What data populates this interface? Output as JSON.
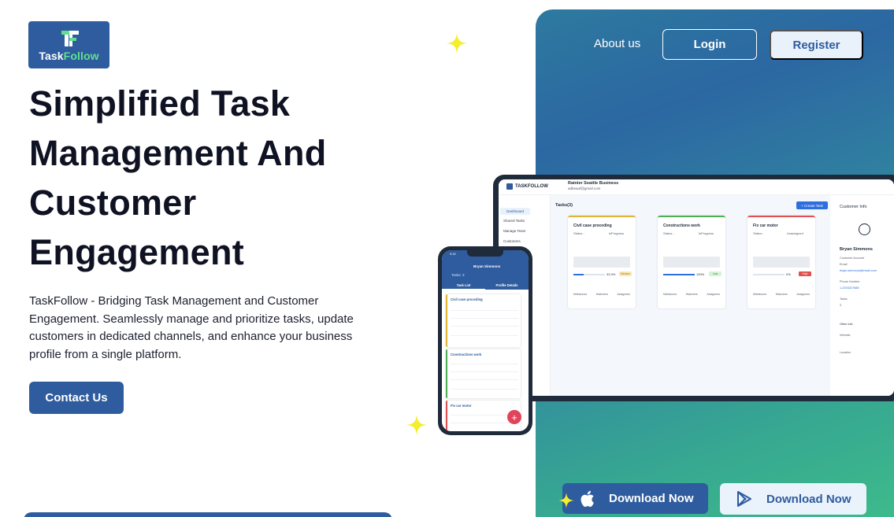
{
  "brand": {
    "logo_text_main": "Task",
    "logo_text_accent": "Follow",
    "brand_color": "#2e5c9e",
    "accent_color": "#5ee08f"
  },
  "hero": {
    "title_line1": "Simplified Task",
    "title_line2": "Management And",
    "title_line3": "Customer",
    "title_line4": "Engagement",
    "description": "TaskFollow - Bridging Task Management and Customer Engagement. Seamlessly manage and prioritize tasks, update customers in dedicated channels, and enhance your business profile from a single platform.",
    "cta_label": "Contact Us"
  },
  "nav": {
    "about": "About us",
    "login": "Login",
    "register": "Register"
  },
  "laptop_mock": {
    "brand": "TASKFOLLOW",
    "business_name": "Rainier Seattle Business",
    "business_email": "adbeauf@gmail.com",
    "sidebar": [
      "Dashboard",
      "Shared Tasks",
      "Manage Team",
      "Customers"
    ],
    "tasks_title": "Tasks(3)",
    "create_button": "+ Create Task",
    "cards": [
      {
        "title": "Civil case proceding",
        "status_label": "Status :",
        "status": "InProgress",
        "progress_pct": "33.3%",
        "progress": 0.333,
        "tag": "Medium",
        "footer": [
          "Milestones",
          "Watchers",
          "Assignees"
        ],
        "color": "#e0b536"
      },
      {
        "title": "Constructions work",
        "status_label": "Status :",
        "status": "InProgress",
        "progress_pct": "100%",
        "progress": 1.0,
        "tag": "Low",
        "footer": [
          "Milestones",
          "Watchers",
          "Assignees"
        ],
        "color": "#4caf50"
      },
      {
        "title": "Fix car motor",
        "status_label": "Status :",
        "status": "Unassigned",
        "progress_pct": "0%",
        "progress": 0.0,
        "tag": "High",
        "footer": [
          "Milestones",
          "Watchers",
          "Assignees"
        ],
        "color": "#e05050"
      }
    ],
    "customer_info": {
      "title": "Customer Info",
      "name": "Bryan Simmons",
      "account_label": "Customer Account",
      "email_label": "Email",
      "email": "bryan.simmons@email.com",
      "phone_label": "Phone Number",
      "phone": "1-2003227688",
      "tasks_label": "Tasks",
      "tasks_count": "3",
      "other_info": "Other info",
      "website_label": "Website",
      "location_label": "Location"
    }
  },
  "phone_mock": {
    "time": "9:32",
    "customer_name": "Bryan Simmons",
    "tasks_label": "Tasks: 3",
    "tabs": [
      "Task List",
      "Profile Details"
    ],
    "cards": [
      {
        "title": "Civil case proceding",
        "color": "#e0b536"
      },
      {
        "title": "Constructions work",
        "color": "#4caf50"
      },
      {
        "title": "Fix car motor",
        "color": "#e05050"
      }
    ],
    "fab": "+"
  },
  "downloads": {
    "apple_label": "Download Now",
    "apple_icon": "apple-icon",
    "play_label": "Download Now",
    "play_icon": "play-store-icon"
  }
}
